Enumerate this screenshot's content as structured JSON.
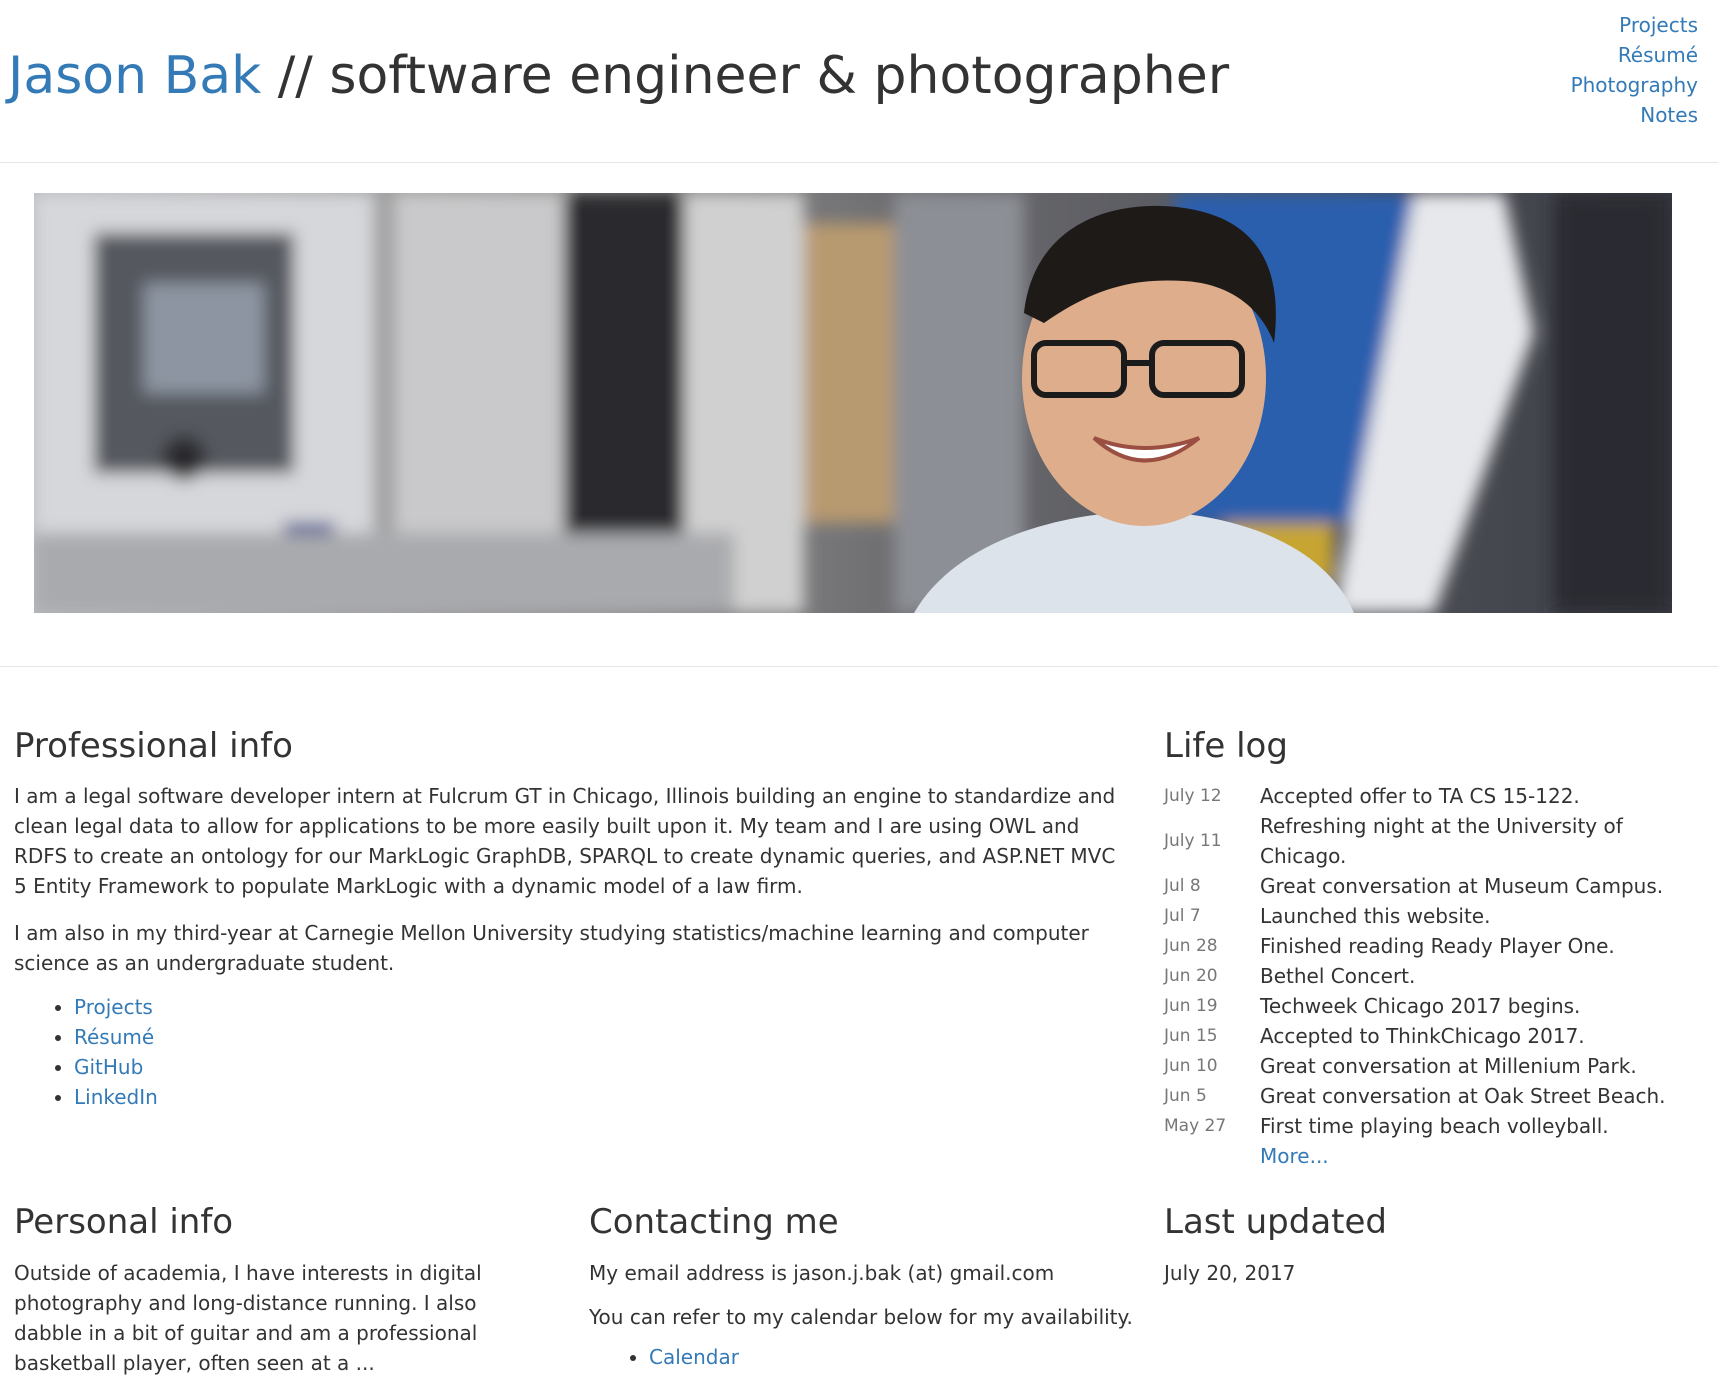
{
  "header": {
    "name": "Jason Bak",
    "tagline": "// software engineer & photographer",
    "nav": [
      "Projects",
      "Résumé",
      "Photography",
      "Notes"
    ]
  },
  "professional": {
    "heading": "Professional info",
    "p1": "I am a legal software developer intern at Fulcrum GT in Chicago, Illinois building an engine to standardize and clean legal data to allow for applications to be more easily built upon it. My team and I are using OWL and RDFS to create an ontology for our MarkLogic GraphDB, SPARQL to create dynamic queries, and ASP.NET MVC 5 Entity Framework to populate MarkLogic with a dynamic model of a law firm.",
    "p2": "I am also in my third-year at Carnegie Mellon University studying statistics/machine learning and computer science as an undergraduate student.",
    "links": [
      "Projects",
      "Résumé",
      "GitHub",
      "LinkedIn"
    ]
  },
  "lifelog": {
    "heading": "Life log",
    "entries": [
      {
        "date": "July 12",
        "text": "Accepted offer to TA CS 15-122."
      },
      {
        "date": "July 11",
        "text": "Refreshing night at the University of Chicago."
      },
      {
        "date": "Jul 8",
        "text": "Great conversation at Museum Campus."
      },
      {
        "date": "Jul 7",
        "text": "Launched this website."
      },
      {
        "date": "Jun 28",
        "text": "Finished reading Ready Player One."
      },
      {
        "date": "Jun 20",
        "text": "Bethel Concert."
      },
      {
        "date": "Jun 19",
        "text": "Techweek Chicago 2017 begins."
      },
      {
        "date": "Jun 15",
        "text": "Accepted to ThinkChicago 2017."
      },
      {
        "date": "Jun 10",
        "text": "Great conversation at Millenium Park."
      },
      {
        "date": "Jun 5",
        "text": "Great conversation at Oak Street Beach."
      },
      {
        "date": "May 27",
        "text": "First time playing beach volleyball."
      }
    ],
    "more": "More..."
  },
  "personal": {
    "heading": "Personal info",
    "text": "Outside of academia, I have interests in digital photography and long-distance running. I also dabble in a bit of guitar and am a professional basketball player, often seen at a ..."
  },
  "contact": {
    "heading": "Contacting me",
    "email_line": "My email address is jason.j.bak (at) gmail.com",
    "calendar_line": "You can refer to my calendar below for my availability.",
    "calendar_link": "Calendar"
  },
  "updated": {
    "heading": "Last updated",
    "date": "July 20, 2017"
  }
}
